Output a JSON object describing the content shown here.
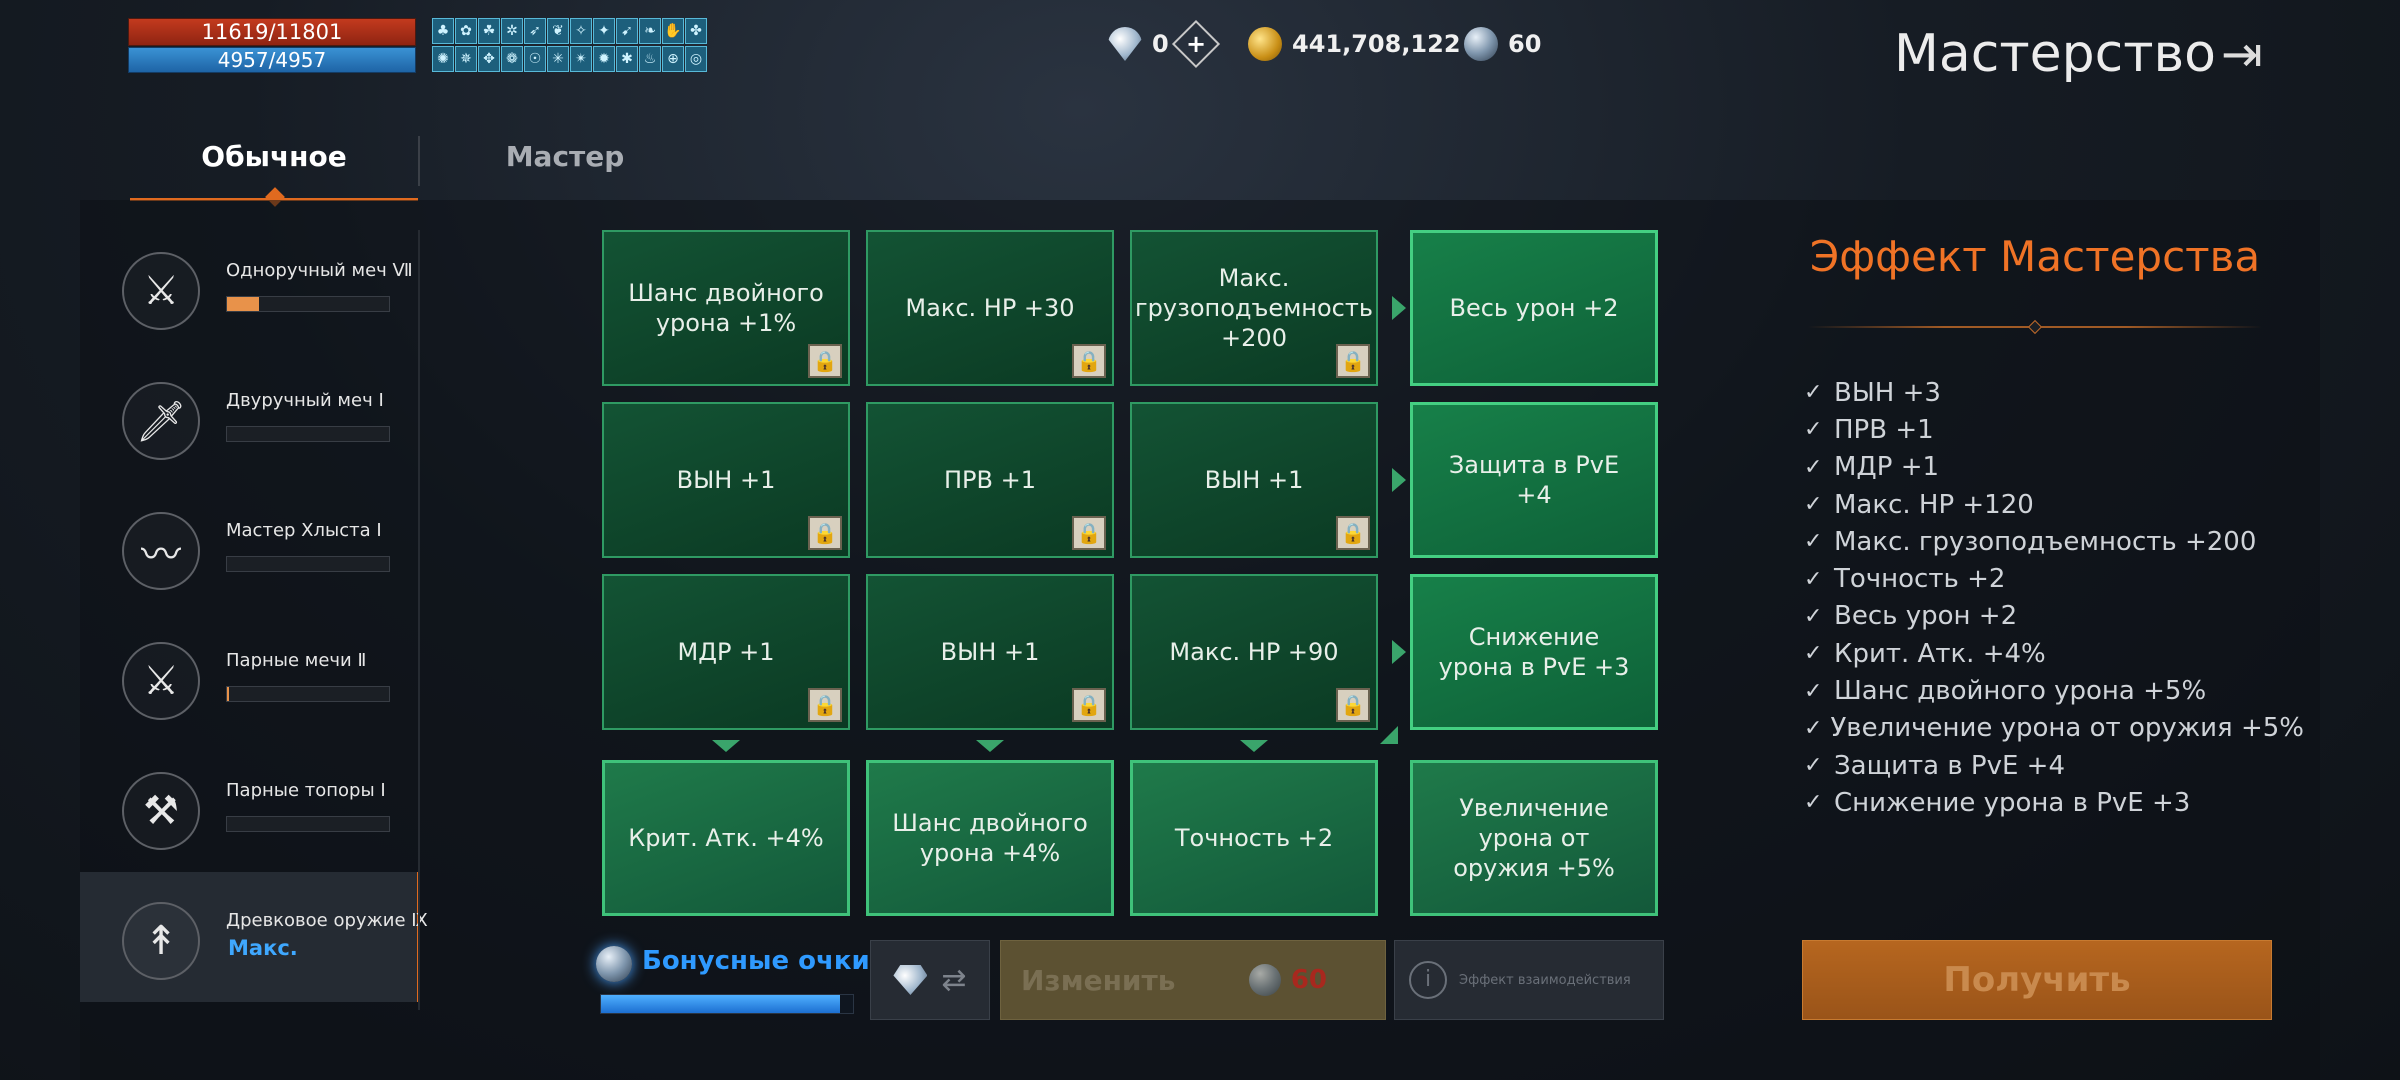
{
  "hud": {
    "hp": "11619/11801",
    "mp": "4957/4957",
    "buff_icons": [
      "♣",
      "✿",
      "☘",
      "✲",
      "➶",
      "❦",
      "✧",
      "✦",
      "➹",
      "❧",
      "✋",
      "✤",
      "✺",
      "✵",
      "✥",
      "❁",
      "☉",
      "✳",
      "✴",
      "✹",
      "✱",
      "♨",
      "⊕",
      "◎"
    ]
  },
  "currency": {
    "diamond_count": "0",
    "add_symbol": "+",
    "gold_count": "441,708,122",
    "orb_count": "60"
  },
  "page": {
    "title": "Мастерство",
    "exit_symbol": "⇥"
  },
  "tabs": [
    {
      "label": "Обычное",
      "active": true
    },
    {
      "label": "Мастер",
      "active": false
    }
  ],
  "sidebar": {
    "items": [
      {
        "name": "Одноручный меч Ⅶ",
        "icon": "⚔",
        "progress": 0.2
      },
      {
        "name": "Двуручный меч Ⅰ",
        "icon": "🗡",
        "progress": 0.0
      },
      {
        "name": "Мастер Хлыста Ⅰ",
        "icon": "〰",
        "progress": 0.0
      },
      {
        "name": "Парные мечи Ⅱ",
        "icon": "⚔",
        "progress": 0.01
      },
      {
        "name": "Парные топоры Ⅰ",
        "icon": "⚒",
        "progress": 0.0
      },
      {
        "name": "Древковое оружие Ⅸ",
        "icon": "↟",
        "status": "Макс."
      }
    ]
  },
  "grid": {
    "rows": [
      [
        "Шанс двойного урона +1%",
        "Макс. НР +30",
        "Макс. грузоподъемность +200",
        "Весь урон +2"
      ],
      [
        "ВЫН +1",
        "ПРВ +1",
        "ВЫН +1",
        "Защита в PvE +4"
      ],
      [
        "МДР +1",
        "ВЫН +1",
        "Макс. НР +90",
        "Снижение урона в PvE +3"
      ],
      [
        "Крит. Атк. +4%",
        "Шанс двойного урона +4%",
        "Точность +2",
        "Увеличение урона от оружия +5%"
      ]
    ],
    "lock_symbol": "🔒"
  },
  "bonus": {
    "label": "Бонусные очки",
    "progress": 0.95
  },
  "buttons": {
    "swap_symbol": "⇄",
    "change_label": "Изменить",
    "change_cost": "60",
    "info_symbol": "i",
    "info_label": "Эффект взаимодействия",
    "get_label": "Получить"
  },
  "effects": {
    "title": "Эффект Мастерства",
    "check_symbol": "✓",
    "items": [
      "ВЫН +3",
      "ПРВ +1",
      "МДР +1",
      "Макс. НР +120",
      "Макс. грузоподъемность +200",
      "Точность +2",
      "Весь урон +2",
      "Крит. Атк. +4%",
      "Шанс двойного урона +5%",
      "Увеличение урона от оружия +5%",
      "Защита в PvE +4",
      "Снижение урона в PvE +3"
    ]
  }
}
